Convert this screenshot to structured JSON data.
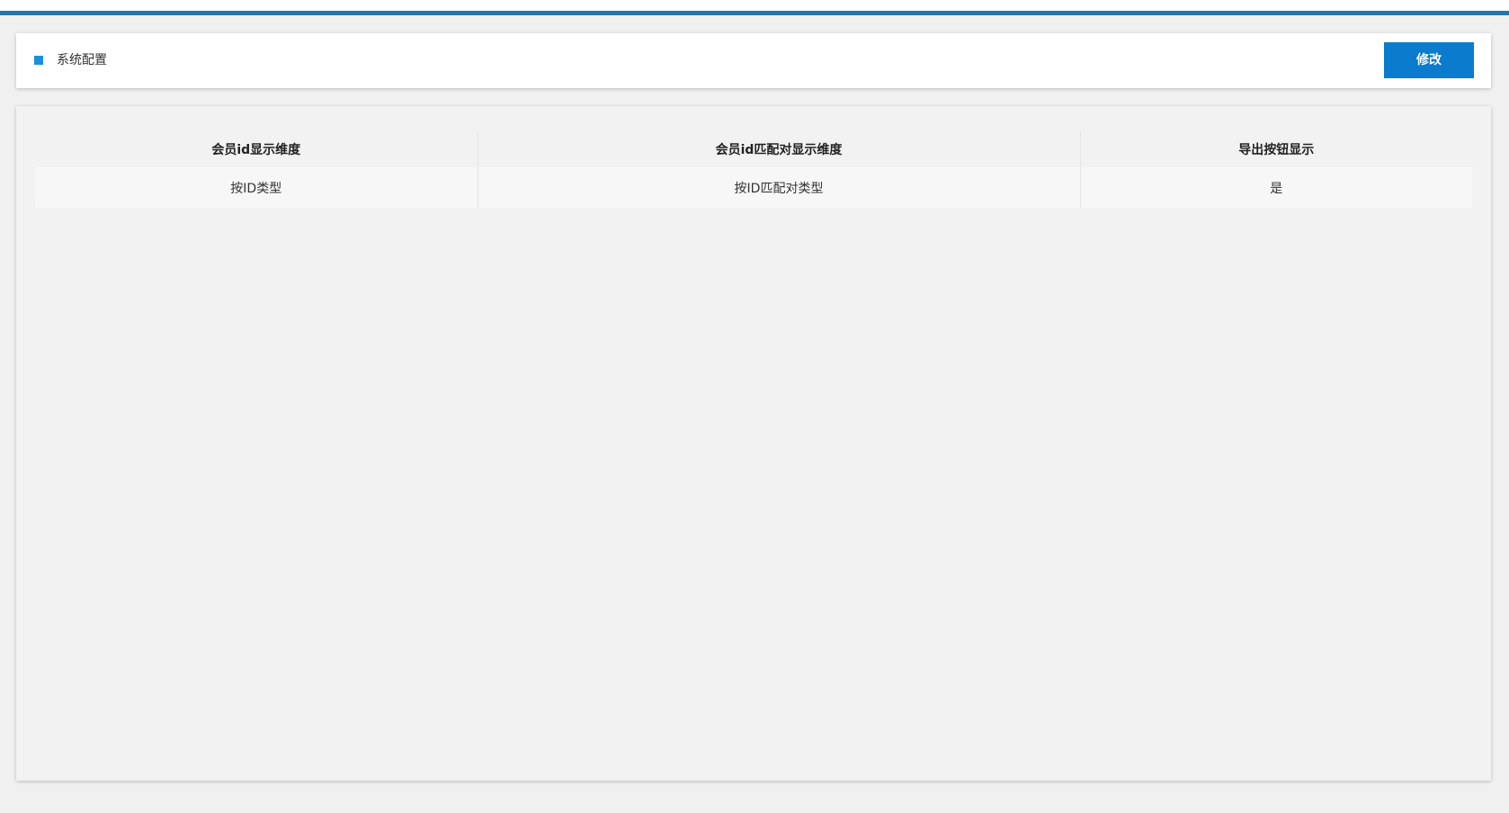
{
  "header": {
    "title": "系统配置",
    "edit_label": "修改"
  },
  "table": {
    "columns": [
      "会员id显示维度",
      "会员id匹配对显示维度",
      "导出按钮显示"
    ],
    "rows": [
      [
        "按ID类型",
        "按ID匹配对类型",
        "是"
      ]
    ]
  },
  "colors": {
    "accent_bar": "#2277a8",
    "bullet": "#1a8fdd",
    "button": "#0a7bcd",
    "page_background": "#f0f0f0"
  }
}
